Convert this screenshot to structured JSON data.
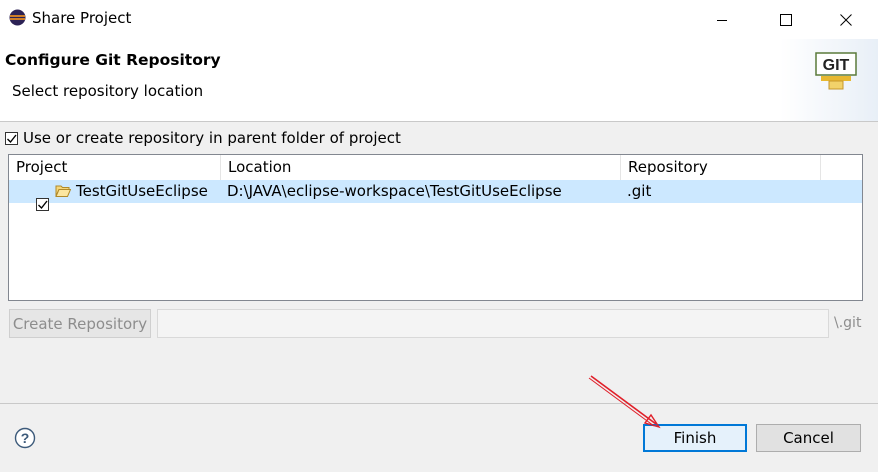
{
  "window": {
    "title": "Share Project",
    "icon": "eclipse-icon",
    "controls": [
      "minimize-icon",
      "maximize-icon",
      "close-icon"
    ]
  },
  "banner": {
    "title": "Configure Git Repository",
    "subtitle": "Select repository location",
    "logo_text": "GIT"
  },
  "parent_folder": {
    "checked": true,
    "label": "Use or create repository in parent folder of project"
  },
  "table": {
    "columns": [
      "Project",
      "Location",
      "Repository"
    ],
    "rows": [
      {
        "checked": true,
        "selected": true,
        "icon": "open-folder-icon",
        "project": "TestGitUseEclipse",
        "location": "D:\\JAVA\\eclipse-workspace\\TestGitUseEclipse",
        "repository": ".git"
      }
    ]
  },
  "create_repo": {
    "button_label": "Create Repository",
    "path_value": "",
    "suffix": "\\.git"
  },
  "footer": {
    "help_icon": "help-icon",
    "finish_label": "Finish",
    "cancel_label": "Cancel"
  },
  "colors": {
    "selection": "#cce8ff",
    "default_button_border": "#0078d7",
    "annotation_arrow": "#e0202a"
  }
}
